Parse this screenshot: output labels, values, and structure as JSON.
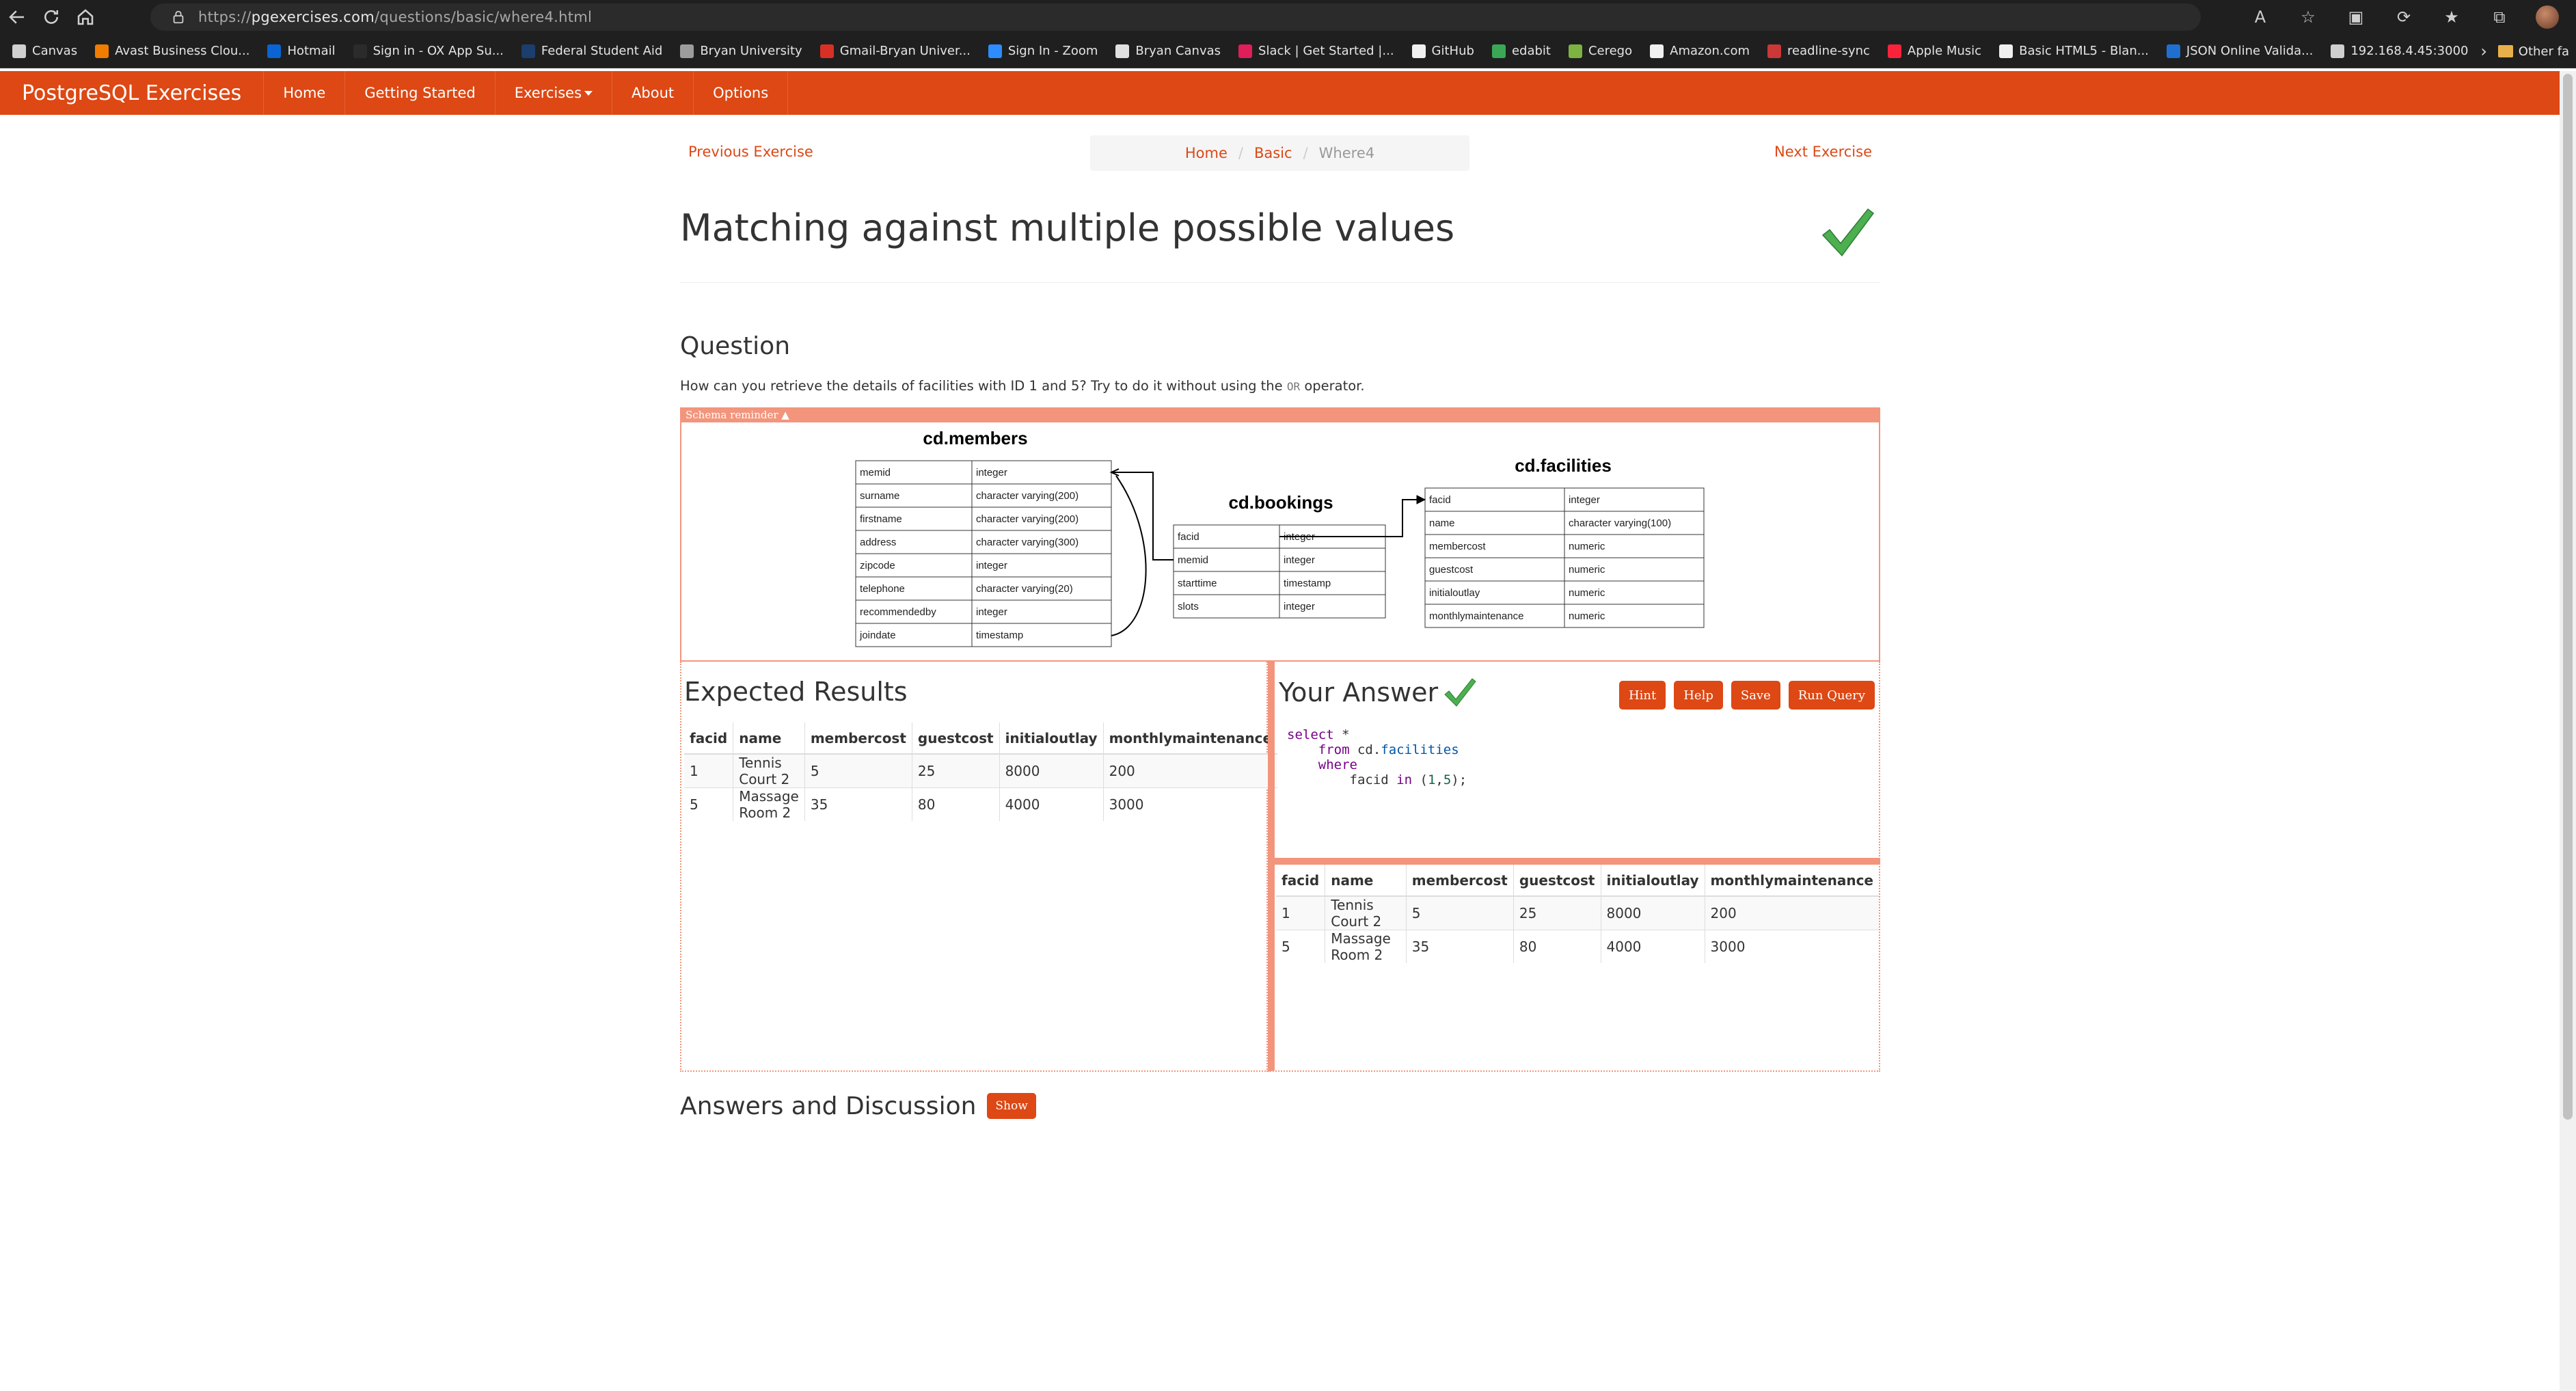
{
  "browser": {
    "url_prefix": "https://",
    "url_host": "pgexercises.com",
    "url_path": "/questions/basic/where4.html",
    "bookmarks": [
      {
        "label": "Canvas",
        "color": "#d0d0d0"
      },
      {
        "label": "Avast Business Clou...",
        "color": "#f07c00"
      },
      {
        "label": "Hotmail",
        "color": "#0a64d4"
      },
      {
        "label": "Sign in - OX App Su...",
        "color": "#2b2b2b"
      },
      {
        "label": "Federal Student Aid",
        "color": "#1a3e6e"
      },
      {
        "label": "Bryan University",
        "color": "#9c9c9c"
      },
      {
        "label": "Gmail-Bryan Univer...",
        "color": "#d93025"
      },
      {
        "label": "Sign In - Zoom",
        "color": "#2d8cff"
      },
      {
        "label": "Bryan Canvas",
        "color": "#e0e0e0"
      },
      {
        "label": "Slack | Get Started |...",
        "color": "#e01e5a"
      },
      {
        "label": "GitHub",
        "color": "#f0f0f0"
      },
      {
        "label": "edabit",
        "color": "#3aa757"
      },
      {
        "label": "Cerego",
        "color": "#7cb342"
      },
      {
        "label": "Amazon.com",
        "color": "#f0f0f0"
      },
      {
        "label": "readline-sync",
        "color": "#cb3837"
      },
      {
        "label": "Apple Music",
        "color": "#fa233b"
      },
      {
        "label": "Basic HTML5 - Blan...",
        "color": "#f0f0f0"
      },
      {
        "label": "JSON Online Valida...",
        "color": "#1f6fd0"
      },
      {
        "label": "192.168.4.45:3000",
        "color": "#cfcfcf"
      }
    ],
    "other_favorites": "Other fa"
  },
  "site": {
    "brand": "PostgreSQL Exercises",
    "nav": [
      "Home",
      "Getting Started",
      "Exercises",
      "About",
      "Options"
    ],
    "accent": "#dd4814"
  },
  "page": {
    "prev": "Previous Exercise",
    "next": "Next Exercise",
    "breadcrumb": {
      "home": "Home",
      "section": "Basic",
      "current": "Where4"
    },
    "title": "Matching against multiple possible values",
    "question_heading": "Question",
    "question_text_before": "How can you retrieve the details of facilities with ID 1 and 5? Try to do it without using the ",
    "question_code": "OR",
    "question_text_after": " operator.",
    "schema_label": "Schema reminder ▲"
  },
  "schema": {
    "members_title": "cd.members",
    "members": [
      [
        "memid",
        "integer"
      ],
      [
        "surname",
        "character varying(200)"
      ],
      [
        "firstname",
        "character varying(200)"
      ],
      [
        "address",
        "character varying(300)"
      ],
      [
        "zipcode",
        "integer"
      ],
      [
        "telephone",
        "character varying(20)"
      ],
      [
        "recommendedby",
        "integer"
      ],
      [
        "joindate",
        "timestamp"
      ]
    ],
    "bookings_title": "cd.bookings",
    "bookings": [
      [
        "facid",
        "integer"
      ],
      [
        "memid",
        "integer"
      ],
      [
        "starttime",
        "timestamp"
      ],
      [
        "slots",
        "integer"
      ]
    ],
    "facilities_title": "cd.facilities",
    "facilities": [
      [
        "facid",
        "integer"
      ],
      [
        "name",
        "character varying(100)"
      ],
      [
        "membercost",
        "numeric"
      ],
      [
        "guestcost",
        "numeric"
      ],
      [
        "initialoutlay",
        "numeric"
      ],
      [
        "monthlymaintenance",
        "numeric"
      ]
    ]
  },
  "expected": {
    "title": "Expected Results",
    "columns": [
      "facid",
      "name",
      "membercost",
      "guestcost",
      "initialoutlay",
      "monthlymaintenance"
    ],
    "rows": [
      [
        "1",
        "Tennis Court 2",
        "5",
        "25",
        "8000",
        "200"
      ],
      [
        "5",
        "Massage Room 2",
        "35",
        "80",
        "4000",
        "3000"
      ]
    ]
  },
  "answer": {
    "title": "Your Answer",
    "buttons": [
      "Hint",
      "Help",
      "Save",
      "Run Query"
    ],
    "code": {
      "l1_kw": "select",
      "l1_sym": " *",
      "l2_kw": "from",
      "l2_tbl_prefix": " cd.",
      "l2_tbl": "facilities",
      "l3_kw": "where",
      "l4_col": "facid ",
      "l4_kw": "in",
      "l4_open": " (",
      "l4_n1": "1",
      "l4_comma": ",",
      "l4_n2": "5",
      "l4_close": ");"
    },
    "columns": [
      "facid",
      "name",
      "membercost",
      "guestcost",
      "initialoutlay",
      "monthlymaintenance"
    ],
    "rows": [
      [
        "1",
        "Tennis Court 2",
        "5",
        "25",
        "8000",
        "200"
      ],
      [
        "5",
        "Massage Room 2",
        "35",
        "80",
        "4000",
        "3000"
      ]
    ]
  },
  "discussion": {
    "title": "Answers and Discussion",
    "button": "Show"
  }
}
